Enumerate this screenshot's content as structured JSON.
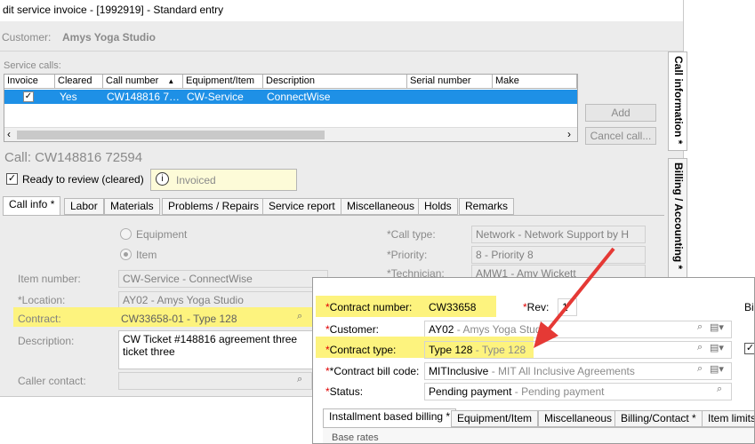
{
  "window": {
    "title": "dit service invoice - [1992919] - Standard entry",
    "customer_label": "Customer:",
    "customer_value": "Amys Yoga Studio"
  },
  "service_calls": {
    "label": "Service calls:",
    "columns": [
      "Invoice",
      "Cleared",
      "Call number",
      "Equipment/Item",
      "Description",
      "Serial number",
      "Make"
    ],
    "row": {
      "cleared": "Yes",
      "call_number": "CW148816 7…",
      "equipment": "CW-Service",
      "description": "ConnectWise"
    },
    "add_label": "Add",
    "cancel_label": "Cancel call..."
  },
  "call": {
    "heading": "Call: CW148816 72594",
    "ready_label": "Ready to review (cleared)",
    "invoiced_label": "Invoiced"
  },
  "tabs": [
    "Call info *",
    "Labor",
    "Materials",
    "Problems / Repairs",
    "Service report",
    "Miscellaneous",
    "Holds",
    "Remarks"
  ],
  "call_info": {
    "equipment_label": "Equipment",
    "item_label": "Item",
    "item_number_label": "Item number:",
    "item_number_value": "CW-Service - ConnectWise",
    "location_label": "*Location:",
    "location_value": "AY02 - Amys Yoga Studio",
    "contract_label": "Contract:",
    "contract_value": "CW33658-01 - Type 128",
    "description_label": "Description:",
    "description_value": "CW Ticket #148816 agreement three ticket three",
    "caller_label": "Caller contact:",
    "call_type_label": "*Call type:",
    "call_type_value": "Network - Network Support by H",
    "priority_label": "*Priority:",
    "priority_value": "8 - Priority 8",
    "technician_label": "*Technician:",
    "technician_value": "AMW1 - Amy Wickett"
  },
  "side_tabs": {
    "call_information": "Call information *",
    "billing": "Billing / Accounting *"
  },
  "popup": {
    "contract_number_label": "Contract number:",
    "contract_number_value": "CW33658",
    "rev_label": "Rev:",
    "rev_value": "1",
    "customer_label": "Customer:",
    "customer_value_code": "AY02",
    "customer_value_name": " - Amys Yoga Studio",
    "contract_type_label": "Contract type:",
    "contract_type_code": "Type 128",
    "contract_type_name": " - Type 128",
    "bill_code_label": "*Contract bill code:",
    "bill_code_code": "MITInclusive",
    "bill_code_name": " - MIT All Inclusive Agreements",
    "status_label": "Status:",
    "status_code": "Pending payment",
    "status_name": " - Pending payment",
    "right_edge_label": "Billi",
    "tabs": [
      "Installment based billing *",
      "Equipment/Item",
      "Miscellaneous",
      "Billing/Contact *",
      "Item limits"
    ],
    "base_rates_label": "Base rates"
  },
  "colors": {
    "selection": "#1e90e6",
    "highlight": "#fdf37e",
    "arrow": "#e53935",
    "required": "#e00000"
  }
}
